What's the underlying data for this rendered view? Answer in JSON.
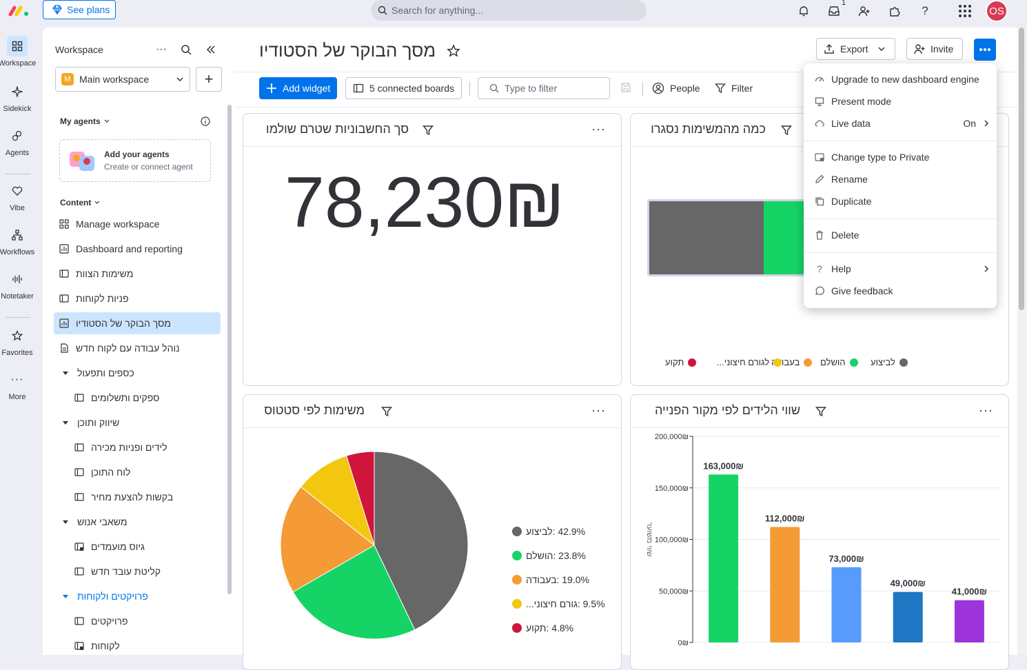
{
  "topbar": {
    "see_plans": "See plans",
    "search_placeholder": "Search for anything...",
    "inbox_badge": "1",
    "avatar_initials": "OS"
  },
  "leftnav": {
    "items": [
      {
        "label": "Workspace"
      },
      {
        "label": "Sidekick"
      },
      {
        "label": "Agents"
      },
      {
        "label": "Vibe"
      },
      {
        "label": "Workflows"
      },
      {
        "label": "Notetaker"
      },
      {
        "label": "Favorites"
      },
      {
        "label": "More"
      }
    ]
  },
  "sidebar": {
    "header": "Workspace",
    "workspace_name": "Main workspace",
    "workspace_initial": "M",
    "my_agents": "My agents",
    "agents_title": "Add your agents",
    "agents_sub": "Create or connect agent",
    "content": "Content",
    "items": [
      {
        "label": "Manage workspace"
      },
      {
        "label": "Dashboard and reporting"
      },
      {
        "label": "משימות הצוות"
      },
      {
        "label": "פניות לקוחות"
      },
      {
        "label": "מסך הבוקר של הסטודיו"
      },
      {
        "label": "נוהל עבודה עם לקוח חדש"
      },
      {
        "label": "כספים ותפעול"
      },
      {
        "label": "ספקים ותשלומים"
      },
      {
        "label": "שיווק ותוכן"
      },
      {
        "label": "לידים ופניות מכירה"
      },
      {
        "label": "לוח התוכן"
      },
      {
        "label": "בקשות להצעת מחיר"
      },
      {
        "label": "משאבי אנוש"
      },
      {
        "label": "גיוס מועמדים"
      },
      {
        "label": "קליטת עובד חדש"
      },
      {
        "label": "פרויקטים ולקוחות"
      },
      {
        "label": "פרויקטים"
      },
      {
        "label": "לקוחות"
      }
    ]
  },
  "main": {
    "title": "מסך הבוקר של הסטודיו",
    "export": "Export",
    "invite": "Invite",
    "add_widget": "Add widget",
    "connected_boards": "5 connected boards",
    "filter_placeholder": "Type to filter",
    "people": "People",
    "filter": "Filter"
  },
  "widgets": {
    "paid_total": {
      "title": "סך החשבוניות שטרם שולמו",
      "value": "78,230₪"
    },
    "tasks_closed": {
      "title": "כמה מהמשימות נסגרו",
      "legend": [
        {
          "label": "לביצוע",
          "color": "#676767"
        },
        {
          "label": "הושלם",
          "color": "#15d465"
        },
        {
          "label": "בעבודה",
          "color": "#f49b36"
        },
        {
          "label": "לגורם חיצוני...",
          "color": "#f3c60f"
        },
        {
          "label": "תקוע",
          "color": "#d0153c"
        }
      ]
    },
    "tasks_by_status": {
      "title": "משימות לפי סטטוס",
      "legend": [
        {
          "label": "לביצוע",
          "pct": ": 42.9%",
          "color": "#676767"
        },
        {
          "label": "הושלם",
          "pct": ": 23.8%",
          "color": "#15d465"
        },
        {
          "label": "בעבודה",
          "pct": ": 19.0%",
          "color": "#f49b36"
        },
        {
          "label": "גורם חיצוני...",
          "pct": ": 9.5%",
          "color": "#f3c60f"
        },
        {
          "label": "תקוע",
          "pct": ": 4.8%",
          "color": "#d0153c"
        }
      ]
    },
    "leads_by_source": {
      "title": "שווי הלידים לפי מקור הפנייה",
      "ylabel": "שווי משוער"
    }
  },
  "chart_data": [
    {
      "type": "pie",
      "title": "משימות לפי סטטוס",
      "categories": [
        "לביצוע",
        "הושלם",
        "בעבודה",
        "גורם חיצוני...",
        "תקוע"
      ],
      "values": [
        42.9,
        23.8,
        19.0,
        9.5,
        4.8
      ],
      "colors": [
        "#676767",
        "#15d465",
        "#f49b36",
        "#f3c60f",
        "#d0153c"
      ]
    },
    {
      "type": "bar",
      "title": "שווי הלידים לפי מקור הפנייה",
      "ylabel": "שווי משוער",
      "ylim": [
        0,
        200000
      ],
      "yticks": [
        "0₪",
        "50,000₪",
        "100,000₪",
        "150,000₪",
        "200,000₪"
      ],
      "values": [
        163000,
        112000,
        73000,
        49000,
        41000
      ],
      "value_labels": [
        "163,000₪",
        "112,000₪",
        "73,000₪",
        "49,000₪",
        "41,000₪"
      ],
      "colors": [
        "#15d465",
        "#f49b36",
        "#579bfc",
        "#1f76c2",
        "#9d34da"
      ]
    },
    {
      "type": "bar",
      "title": "כמה מהמשימות נסגרו",
      "orientation": "stacked-horizontal",
      "categories": [
        "לביצוע",
        "הושלם"
      ],
      "colors": [
        "#676767",
        "#15d465"
      ]
    }
  ],
  "menu": {
    "items": [
      {
        "label": "Upgrade to new dashboard engine"
      },
      {
        "label": "Present mode"
      },
      {
        "label": "Live data",
        "value": "On"
      },
      {
        "label": "Change type to Private"
      },
      {
        "label": "Rename"
      },
      {
        "label": "Duplicate"
      },
      {
        "label": "Delete"
      },
      {
        "label": "Help"
      },
      {
        "label": "Give feedback"
      }
    ]
  }
}
